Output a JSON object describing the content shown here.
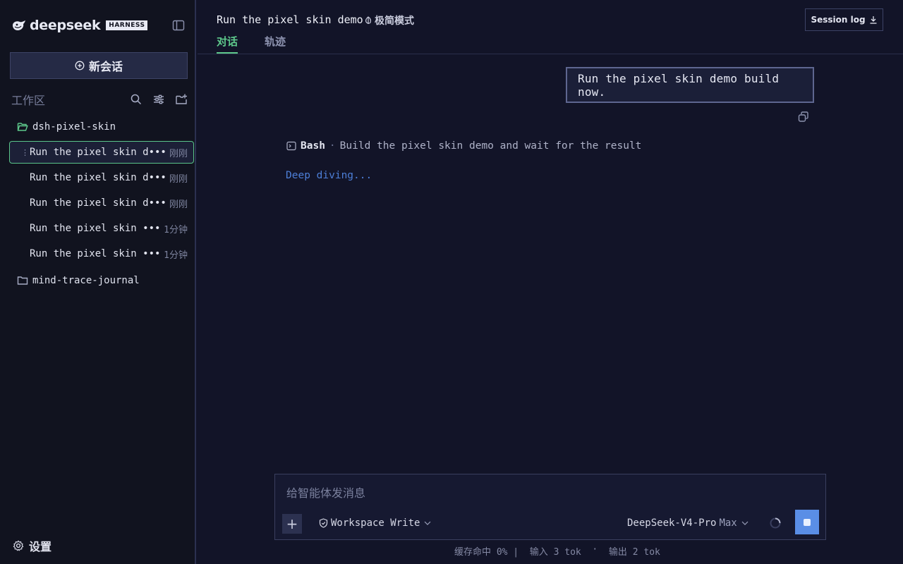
{
  "app": {
    "brand_name": "deepseek",
    "brand_badge": "HARNESS"
  },
  "sidebar": {
    "new_chat_label": "新会话",
    "workspace_title": "工作区",
    "folders": [
      {
        "name": "dsh-pixel-skin",
        "expanded": true,
        "sessions": [
          {
            "title": "Run the pixel skin d•••",
            "time": "刚刚",
            "selected": true
          },
          {
            "title": "Run the pixel skin d•••",
            "time": "刚刚",
            "selected": false
          },
          {
            "title": "Run the pixel skin d•••",
            "time": "刚刚",
            "selected": false
          },
          {
            "title": "Run the pixel skin •••",
            "time": "1分钟",
            "selected": false
          },
          {
            "title": "Run the pixel skin •••",
            "time": "1分钟",
            "selected": false
          }
        ]
      },
      {
        "name": "mind-trace-journal",
        "expanded": false
      }
    ],
    "settings_label": "设置"
  },
  "header": {
    "title": "Run the pixel skin demo",
    "mode_label": "极简模式",
    "tabs": [
      {
        "label": "对话",
        "active": true
      },
      {
        "label": "轨迹",
        "active": false
      }
    ],
    "session_log_label": "Session log"
  },
  "conversation": {
    "user_message": "Run the pixel skin demo build now.",
    "tool_call": {
      "tool": "Bash",
      "description": "Build the pixel skin demo and wait for the result"
    },
    "status_text": "Deep diving..."
  },
  "composer": {
    "placeholder": "给智能体发消息",
    "value": "",
    "permission_label": "Workspace Write",
    "model_name": "DeepSeek-V4-Pro",
    "model_level": "Max"
  },
  "footer": {
    "cache_hit": "缓存命中 0% | ",
    "input_tokens": " 输入 3 tok ",
    "separator": " · ",
    "output_tokens": " 输出 2 tok"
  },
  "colors": {
    "accent_green": "#5ec98c",
    "accent_blue": "#5a8ee6",
    "status_blue": "#4d7fd8",
    "background": "#121428"
  }
}
